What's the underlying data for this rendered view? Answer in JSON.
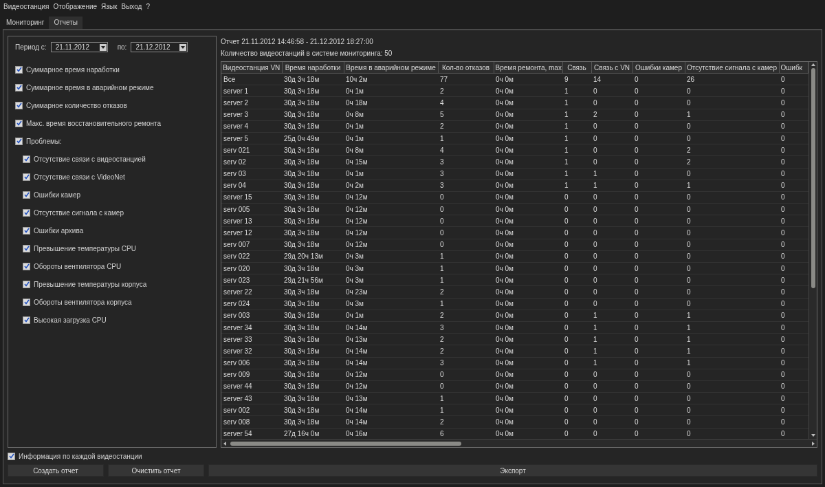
{
  "menu": [
    "Видеостанция",
    "Отображение",
    "Язык",
    "Выход",
    "?"
  ],
  "tabs": [
    {
      "label": "Мониторинг",
      "selected": false
    },
    {
      "label": "Отчеты",
      "selected": true
    }
  ],
  "period": {
    "from_label": "Период с:",
    "from": "21.11.2012",
    "to_label": "по:",
    "to": "21.12.2012"
  },
  "options": [
    {
      "label": "Суммарное время наработки",
      "checked": true
    },
    {
      "label": "Суммарное время в аварийном режиме",
      "checked": true
    },
    {
      "label": "Суммарное количество отказов",
      "checked": true
    },
    {
      "label": "Макс. время восстановительного ремонта",
      "checked": true
    },
    {
      "label": "Проблемы:",
      "checked": true,
      "children": [
        {
          "label": "Отсутствие связи с видеостанцией",
          "checked": true
        },
        {
          "label": "Отсутствие связи с VideoNet",
          "checked": true
        },
        {
          "label": "Ошибки камер",
          "checked": true
        },
        {
          "label": "Отсутствие сигнала с камер",
          "checked": true
        },
        {
          "label": "Ошибки архива",
          "checked": true
        },
        {
          "label": "Превышение температуры CPU",
          "checked": true
        },
        {
          "label": "Обороты вентилятора CPU",
          "checked": true
        },
        {
          "label": "Превышение температуры корпуса",
          "checked": true
        },
        {
          "label": "Обороты вентилятора корпуса",
          "checked": true
        },
        {
          "label": "Высокая загрузка CPU",
          "checked": true
        }
      ]
    }
  ],
  "report": {
    "title": "Отчет 21.11.2012 14:46:58 - 21.12.2012 18:27:00",
    "count": "Количество видеостанций в системе мониторинга: 50"
  },
  "table": {
    "columns": [
      "Видеостанция VN",
      "Время наработки",
      "Время в аварийном режиме",
      "Кол-во отказов",
      "Время ремонта, max",
      "Связь",
      "Связь с VN",
      "Ошибки камер",
      "Отсутствие сигнала с камер",
      "Ошибк"
    ],
    "rows": [
      [
        "Все",
        "30д 3ч 18м",
        "10ч 2м",
        "77",
        "0ч 0м",
        "9",
        "14",
        "0",
        "26",
        "0"
      ],
      [
        "server 1",
        "30д 3ч 18м",
        "0ч 1м",
        "2",
        "0ч 0м",
        "1",
        "0",
        "0",
        "0",
        "0"
      ],
      [
        "server 2",
        "30д 3ч 18м",
        "0ч 18м",
        "4",
        "0ч 0м",
        "1",
        "0",
        "0",
        "0",
        "0"
      ],
      [
        "server 3",
        "30д 3ч 18м",
        "0ч 8м",
        "5",
        "0ч 0м",
        "1",
        "2",
        "0",
        "1",
        "0"
      ],
      [
        "server 4",
        "30д 3ч 18м",
        "0ч 1м",
        "2",
        "0ч 0м",
        "1",
        "0",
        "0",
        "0",
        "0"
      ],
      [
        "server 5",
        "25д 0ч 49м",
        "0ч 1м",
        "1",
        "0ч 0м",
        "1",
        "0",
        "0",
        "0",
        "0"
      ],
      [
        "serv 021",
        "30д 3ч 18м",
        "0ч 8м",
        "4",
        "0ч 0м",
        "1",
        "0",
        "0",
        "2",
        "0"
      ],
      [
        "serv 02",
        "30д 3ч 18м",
        "0ч 15м",
        "3",
        "0ч 0м",
        "1",
        "0",
        "0",
        "2",
        "0"
      ],
      [
        "serv 03",
        "30д 3ч 18м",
        "0ч 1м",
        "3",
        "0ч 0м",
        "1",
        "1",
        "0",
        "0",
        "0"
      ],
      [
        "serv 04",
        "30д 3ч 18м",
        "0ч 2м",
        "3",
        "0ч 0м",
        "1",
        "1",
        "0",
        "1",
        "0"
      ],
      [
        "server 15",
        "30д 3ч 18м",
        "0ч 12м",
        "0",
        "0ч 0м",
        "0",
        "0",
        "0",
        "0",
        "0"
      ],
      [
        "serv 005",
        "30д 3ч 18м",
        "0ч 12м",
        "0",
        "0ч 0м",
        "0",
        "0",
        "0",
        "0",
        "0"
      ],
      [
        "server 13",
        "30д 3ч 18м",
        "0ч 12м",
        "0",
        "0ч 0м",
        "0",
        "0",
        "0",
        "0",
        "0"
      ],
      [
        "server 12",
        "30д 3ч 18м",
        "0ч 12м",
        "0",
        "0ч 0м",
        "0",
        "0",
        "0",
        "0",
        "0"
      ],
      [
        "serv 007",
        "30д 3ч 18м",
        "0ч 12м",
        "0",
        "0ч 0м",
        "0",
        "0",
        "0",
        "0",
        "0"
      ],
      [
        "serv 022",
        "29д 20ч 13м",
        "0ч 3м",
        "1",
        "0ч 0м",
        "0",
        "0",
        "0",
        "0",
        "0"
      ],
      [
        "serv 020",
        "30д 3ч 18м",
        "0ч 3м",
        "1",
        "0ч 0м",
        "0",
        "0",
        "0",
        "0",
        "0"
      ],
      [
        "serv 023",
        "29д 21ч 56м",
        "0ч 3м",
        "1",
        "0ч 0м",
        "0",
        "0",
        "0",
        "0",
        "0"
      ],
      [
        "server 22",
        "30д 3ч 18м",
        "0ч 23м",
        "2",
        "0ч 0м",
        "0",
        "0",
        "0",
        "0",
        "0"
      ],
      [
        "serv 024",
        "30д 3ч 18м",
        "0ч 3м",
        "1",
        "0ч 0м",
        "0",
        "0",
        "0",
        "0",
        "0"
      ],
      [
        "serv 003",
        "30д 3ч 18м",
        "0ч 1м",
        "2",
        "0ч 0м",
        "0",
        "1",
        "0",
        "1",
        "0"
      ],
      [
        "server 34",
        "30д 3ч 18м",
        "0ч 14м",
        "3",
        "0ч 0м",
        "0",
        "1",
        "0",
        "1",
        "0"
      ],
      [
        "server 33",
        "30д 3ч 18м",
        "0ч 13м",
        "2",
        "0ч 0м",
        "0",
        "1",
        "0",
        "1",
        "0"
      ],
      [
        "server 32",
        "30д 3ч 18м",
        "0ч 14м",
        "2",
        "0ч 0м",
        "0",
        "1",
        "0",
        "1",
        "0"
      ],
      [
        "serv 006",
        "30д 3ч 18м",
        "0ч 14м",
        "3",
        "0ч 0м",
        "0",
        "1",
        "0",
        "1",
        "0"
      ],
      [
        "serv 009",
        "30д 3ч 18м",
        "0ч 12м",
        "0",
        "0ч 0м",
        "0",
        "0",
        "0",
        "0",
        "0"
      ],
      [
        "server 44",
        "30д 3ч 18м",
        "0ч 12м",
        "0",
        "0ч 0м",
        "0",
        "0",
        "0",
        "0",
        "0"
      ],
      [
        "server 43",
        "30д 3ч 18м",
        "0ч 13м",
        "1",
        "0ч 0м",
        "0",
        "0",
        "0",
        "0",
        "0"
      ],
      [
        "serv 002",
        "30д 3ч 18м",
        "0ч 14м",
        "1",
        "0ч 0м",
        "0",
        "0",
        "0",
        "0",
        "0"
      ],
      [
        "serv 008",
        "30д 3ч 18м",
        "0ч 14м",
        "2",
        "0ч 0м",
        "0",
        "0",
        "0",
        "0",
        "0"
      ],
      [
        "server 54",
        "27д 16ч 0м",
        "0ч 16м",
        "6",
        "0ч 0м",
        "0",
        "0",
        "0",
        "0",
        "0"
      ]
    ]
  },
  "per_station": {
    "label": "Информация по каждой видеостанции",
    "checked": true
  },
  "buttons": [
    "Создать отчет",
    "Очистить отчет",
    "Экспорт"
  ]
}
